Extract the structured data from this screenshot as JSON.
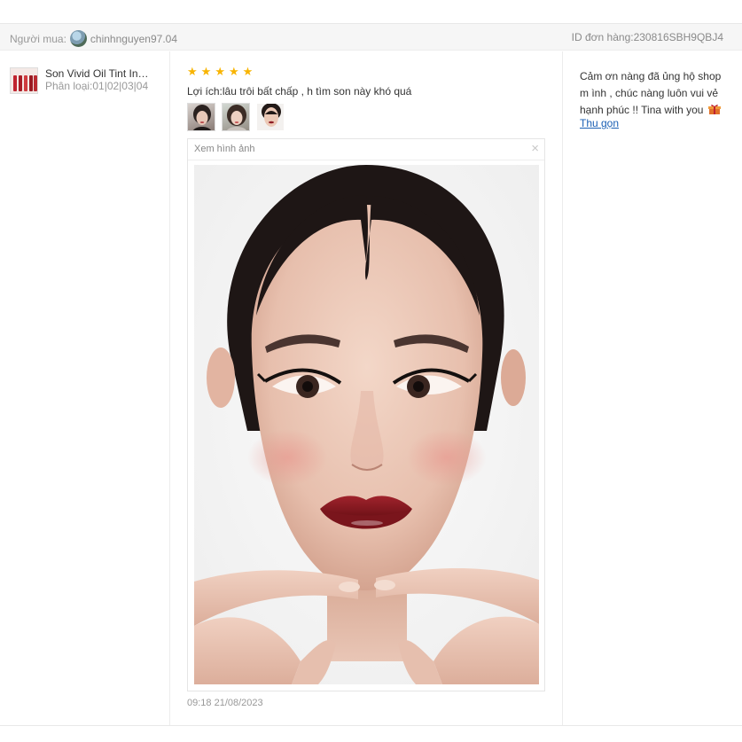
{
  "header": {
    "buyer_label": "Người mua:",
    "buyer_name": "chinhnguyen97.04",
    "order_id": "ID đơn hàng:230816SBH9QBJ4"
  },
  "product": {
    "name": "Son Vivid Oil Tint Inni...",
    "variant": "Phân loại:01|02|03|04"
  },
  "review": {
    "rating": 5,
    "stars": [
      "★",
      "★",
      "★",
      "★",
      "★"
    ],
    "text": "Lợi ích:lâu trôi bất chấp , h tìm son này khó quá",
    "timestamp": "09:18 21/08/2023"
  },
  "viewer": {
    "title": "Xem hình ảnh",
    "close_glyph": "×"
  },
  "reply": {
    "text": "Cảm ơn nàng đã ủng hộ shop m ình , chúc nàng luôn vui vẻ hạnh phúc !! Tina with you",
    "collapse_label": "Thu gọn"
  },
  "colors": {
    "star": "#f8b400",
    "link": "#1a5fb4",
    "lip": "#8e1c24"
  }
}
